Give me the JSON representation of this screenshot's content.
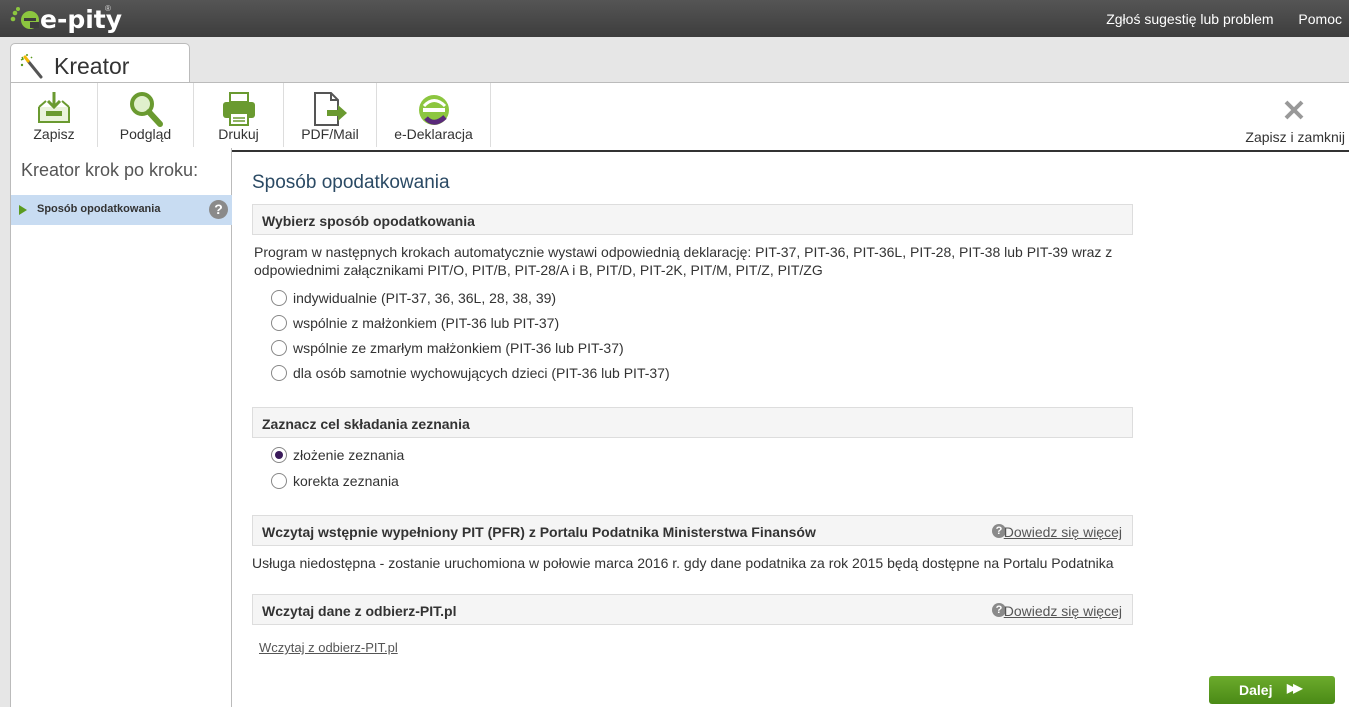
{
  "app": {
    "logo_text": "e-pity",
    "logo_reg": "®",
    "top_links": [
      "Zgłoś sugestię lub problem",
      "Pomoc"
    ]
  },
  "tab": {
    "title": "Kreator",
    "icon": "wand-icon"
  },
  "toolbar": {
    "buttons": [
      {
        "label": "Zapisz",
        "icon": "save-icon"
      },
      {
        "label": "Podgląd",
        "icon": "magnifier-icon"
      },
      {
        "label": "Drukuj",
        "icon": "printer-icon"
      },
      {
        "label": "PDF/Mail",
        "icon": "pdf-export-icon"
      },
      {
        "label": "e-Deklaracja",
        "icon": "e-declaration-icon"
      }
    ],
    "close_label": "Zapisz i zamknij"
  },
  "sidebar": {
    "heading": "Kreator krok po kroku:",
    "items": [
      {
        "label": "Sposób opodatkowania",
        "help": "?"
      }
    ]
  },
  "main": {
    "title": "Sposób opodatkowania",
    "section1": {
      "title": "Wybierz sposób opodatkowania",
      "description": "Program w następnych krokach automatycznie wystawi odpowiednią deklarację: PIT-37, PIT-36, PIT-36L, PIT-28, PIT-38 lub PIT-39 wraz z odpowiednimi załącznikami PIT/O, PIT/B, PIT-28/A i B, PIT/D, PIT-2K, PIT/M, PIT/Z, PIT/ZG",
      "options": [
        "indywidualnie (PIT-37, 36, 36L, 28, 38, 39)",
        "wspólnie z małżonkiem (PIT-36 lub PIT-37)",
        "wspólnie ze zmarłym małżonkiem (PIT-36 lub PIT-37)",
        "dla osób samotnie wychowujących dzieci (PIT-36 lub PIT-37)"
      ]
    },
    "section2": {
      "title": "Zaznacz cel składania zeznania",
      "options": [
        "złożenie zeznania",
        "korekta zeznania"
      ],
      "selected": "złożenie zeznania"
    },
    "section3": {
      "title": "Wczytaj wstępnie wypełniony PIT (PFR) z Portalu Podatnika Ministerstwa Finansów",
      "more": "Dowiedz się więcej",
      "info": "Usługa niedostępna - zostanie uruchomiona w połowie marca 2016 r. gdy dane podatnika za rok 2015 będą dostępne na Portalu Podatnika"
    },
    "section4": {
      "title": "Wczytaj dane z odbierz-PIT.pl",
      "more": "Dowiedz się więcej",
      "link": "Wczytaj z odbierz-PIT.pl"
    },
    "next_button": "Dalej",
    "next_arrows": "▶▶"
  },
  "colors": {
    "accent_green": "#5a9b1f",
    "title_blue": "#2b4a64",
    "sidebar_selected": "#c8dcf2"
  }
}
